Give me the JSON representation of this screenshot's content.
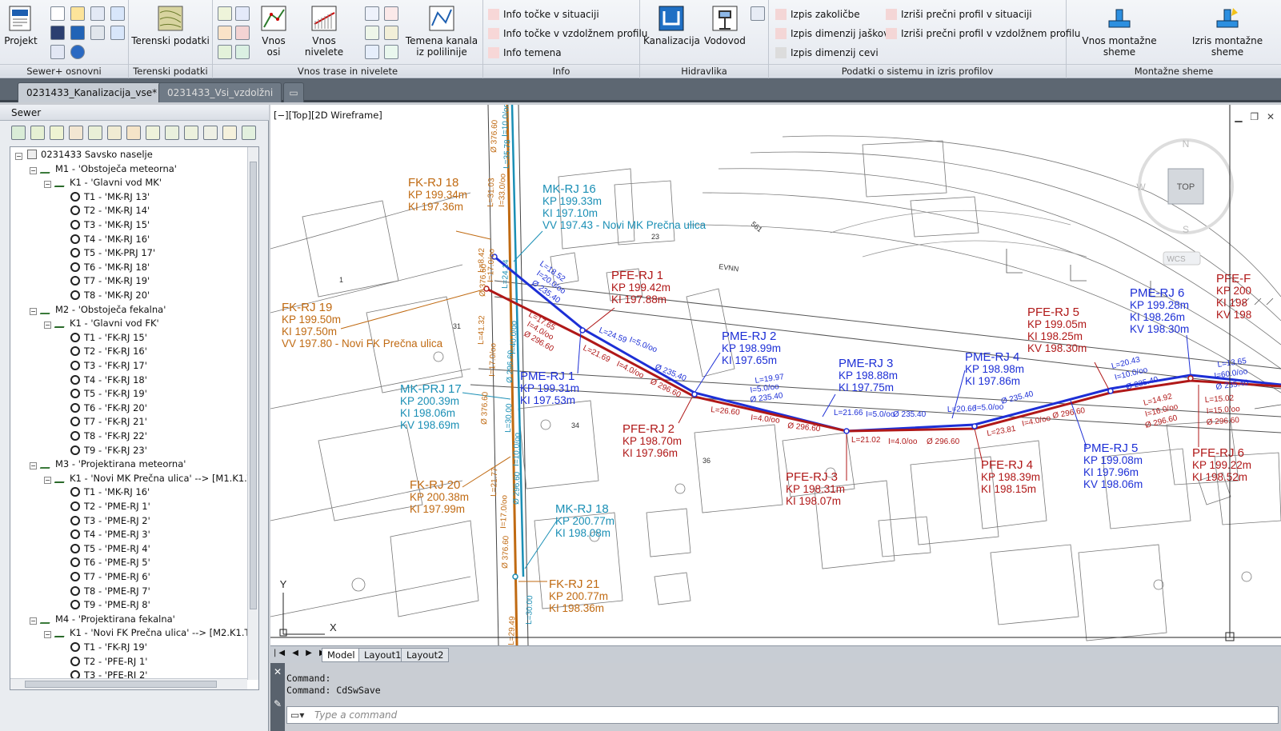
{
  "ribbon": {
    "groups": [
      {
        "label": "Sewer+ osnovni"
      },
      {
        "label": "Terenski podatki"
      },
      {
        "label": "Vnos trase in nivelete"
      },
      {
        "label": "Info"
      },
      {
        "label": "Hidravlika"
      },
      {
        "label": "Podatki o sistemu in izris profilov"
      },
      {
        "label": "Montažne sheme"
      }
    ],
    "buttons": {
      "projekt": "Projekt",
      "terenski": "Terenski podatki",
      "vnos_osi": "Vnos osi",
      "vnos_nivelete": "Vnos nivelete",
      "temena_1": "Temena kanala",
      "temena_2": "iz polilinije",
      "info_situacija": "Info točke v situaciji",
      "info_vzdolzni": "Info točke v vzdolžnem profilu",
      "info_temena": "Info temena",
      "kanalizacija": "Kanalizacija",
      "vodovod": "Vodovod",
      "izpis_zakolicbe": "Izpis zakoličbe",
      "izpis_jaskov": "Izpis dimenzij jaškov",
      "izpis_cevi": "Izpis dimenzij cevi",
      "precni_situacija": "Izriši prečni profil v situaciji",
      "precni_vzdolzni": "Izriši prečni profil v vzdolžnem profilu",
      "vnos_montazne": "Vnos montažne sheme",
      "izris_montazne": "Izris montažne sheme"
    }
  },
  "doc_tabs": [
    {
      "label": "0231433_Kanalizacija_vse*",
      "active": true
    },
    {
      "label": "0231433_Vsi_vzdolžni",
      "active": false
    }
  ],
  "panel": {
    "title": "Sewer",
    "tree": [
      {
        "level": 0,
        "label": "0231433 Savsko naselje",
        "kind": "root"
      },
      {
        "level": 1,
        "label": "M1 - 'Obstoječa meteorna'",
        "kind": "net"
      },
      {
        "level": 2,
        "label": "K1 - 'Glavni vod MK'",
        "kind": "line"
      },
      {
        "level": 3,
        "label": "T1 - 'MK-RJ 13'",
        "kind": "pt"
      },
      {
        "level": 3,
        "label": "T2 - 'MK-RJ 14'",
        "kind": "pt"
      },
      {
        "level": 3,
        "label": "T3 - 'MK-RJ 15'",
        "kind": "pt"
      },
      {
        "level": 3,
        "label": "T4 - 'MK-RJ 16'",
        "kind": "pt"
      },
      {
        "level": 3,
        "label": "T5 - 'MK-PRJ 17'",
        "kind": "pt"
      },
      {
        "level": 3,
        "label": "T6 - 'MK-RJ 18'",
        "kind": "pt"
      },
      {
        "level": 3,
        "label": "T7 - 'MK-RJ 19'",
        "kind": "pt"
      },
      {
        "level": 3,
        "label": "T8 - 'MK-RJ 20'",
        "kind": "pt"
      },
      {
        "level": 1,
        "label": "M2 - 'Obstoječa fekalna'",
        "kind": "net"
      },
      {
        "level": 2,
        "label": "K1 - 'Glavni vod FK'",
        "kind": "line"
      },
      {
        "level": 3,
        "label": "T1 - 'FK-RJ 15'",
        "kind": "pt"
      },
      {
        "level": 3,
        "label": "T2 - 'FK-RJ 16'",
        "kind": "pt"
      },
      {
        "level": 3,
        "label": "T3 - 'FK-RJ 17'",
        "kind": "pt"
      },
      {
        "level": 3,
        "label": "T4 - 'FK-RJ 18'",
        "kind": "pt"
      },
      {
        "level": 3,
        "label": "T5 - 'FK-RJ 19'",
        "kind": "pt"
      },
      {
        "level": 3,
        "label": "T6 - 'FK-RJ 20'",
        "kind": "pt"
      },
      {
        "level": 3,
        "label": "T7 - 'FK-RJ 21'",
        "kind": "pt"
      },
      {
        "level": 3,
        "label": "T8 - 'FK-RJ 22'",
        "kind": "pt"
      },
      {
        "level": 3,
        "label": "T9 - 'FK-RJ 23'",
        "kind": "pt"
      },
      {
        "level": 1,
        "label": "M3 - 'Projektirana meteorna'",
        "kind": "net"
      },
      {
        "level": 2,
        "label": "K1 - 'Novi MK Prečna ulica'  --> [M1.K1.T",
        "kind": "line"
      },
      {
        "level": 3,
        "label": "T1 - 'MK-RJ 16'",
        "kind": "pt"
      },
      {
        "level": 3,
        "label": "T2 - 'PME-RJ 1'",
        "kind": "pt"
      },
      {
        "level": 3,
        "label": "T3 - 'PME-RJ 2'",
        "kind": "pt"
      },
      {
        "level": 3,
        "label": "T4 - 'PME-RJ 3'",
        "kind": "pt"
      },
      {
        "level": 3,
        "label": "T5 - 'PME-RJ 4'",
        "kind": "pt"
      },
      {
        "level": 3,
        "label": "T6 - 'PME-RJ 5'",
        "kind": "pt"
      },
      {
        "level": 3,
        "label": "T7 - 'PME-RJ 6'",
        "kind": "pt"
      },
      {
        "level": 3,
        "label": "T8 - 'PME-RJ 7'",
        "kind": "pt"
      },
      {
        "level": 3,
        "label": "T9 - 'PME-RJ 8'",
        "kind": "pt"
      },
      {
        "level": 1,
        "label": "M4 - 'Projektirana fekalna'",
        "kind": "net"
      },
      {
        "level": 2,
        "label": "K1 - 'Novi FK Prečna ulica'  --> [M2.K1.T",
        "kind": "line"
      },
      {
        "level": 3,
        "label": "T1 - 'FK-RJ 19'",
        "kind": "pt"
      },
      {
        "level": 3,
        "label": "T2 - 'PFE-RJ 1'",
        "kind": "pt"
      },
      {
        "level": 3,
        "label": "T3 - 'PFE-RJ 2'",
        "kind": "pt"
      }
    ]
  },
  "viewport": {
    "label": "[−][Top][2D Wireframe]",
    "viewcube": {
      "top": "TOP",
      "n": "N",
      "s": "S",
      "w": "W",
      "wcs": "WCS"
    },
    "axis": {
      "y": "Y",
      "x": "X"
    },
    "labels": [
      {
        "c": "#c06a12",
        "lines": [
          "FK-RJ 18",
          "KP 199.34m",
          "KI 197.36m"
        ]
      },
      {
        "c": "#1a8fb5",
        "lines": [
          "MK-RJ 16",
          "KP 199.33m",
          "KI 197.10m",
          "VV 197.43 - Novi MK Prečna ulica"
        ]
      },
      {
        "c": "#c06a12",
        "lines": [
          "FK-RJ 19",
          "KP 199.50m",
          "KI 197.50m",
          "VV 197.80 - Novi FK Prečna ulica"
        ]
      },
      {
        "c": "#b01818",
        "lines": [
          "PFE-RJ 1",
          "KP 199.42m",
          "KI 197.88m"
        ]
      },
      {
        "c": "#1a8fb5",
        "lines": [
          "MK-PRJ 17",
          "KP 200.39m",
          "KI 198.06m",
          "KV 198.69m"
        ]
      },
      {
        "c": "#1d2fd6",
        "lines": [
          "PME-RJ 1",
          "KP 199.31m",
          "KI 197.53m"
        ]
      },
      {
        "c": "#1d2fd6",
        "lines": [
          "PME-RJ 2",
          "KP 198.99m",
          "KI 197.65m"
        ]
      },
      {
        "c": "#1d2fd6",
        "lines": [
          "PME-RJ 3",
          "KP 198.88m",
          "KI 197.75m"
        ]
      },
      {
        "c": "#1d2fd6",
        "lines": [
          "PME-RJ 4",
          "KP 198.98m",
          "KI 197.86m"
        ]
      },
      {
        "c": "#b01818",
        "lines": [
          "PFE-RJ 5",
          "KP 199.05m",
          "KI 198.25m",
          "KV 198.30m"
        ]
      },
      {
        "c": "#1d2fd6",
        "lines": [
          "PME-RJ 6",
          "KP 199.28m",
          "KI 198.26m",
          "KV 198.30m"
        ]
      },
      {
        "c": "#b01818",
        "lines": [
          "PFE-RJ 2",
          "KP 198.70m",
          "KI 197.96m"
        ]
      },
      {
        "c": "#c06a12",
        "lines": [
          "FK-RJ 20",
          "KP 200.38m",
          "KI 197.99m"
        ]
      },
      {
        "c": "#b01818",
        "lines": [
          "PFE-RJ 3",
          "KP 198.31m",
          "KI 198.07m"
        ]
      },
      {
        "c": "#b01818",
        "lines": [
          "PFE-RJ 4",
          "KP 198.39m",
          "KI 198.15m"
        ]
      },
      {
        "c": "#1d2fd6",
        "lines": [
          "PME-RJ 5",
          "KP 199.08m",
          "KI 197.96m",
          "KV 198.06m"
        ]
      },
      {
        "c": "#b01818",
        "lines": [
          "PFE-RJ 6",
          "KP 199.22m",
          "KI 198.52m"
        ]
      },
      {
        "c": "#1a8fb5",
        "lines": [
          "MK-RJ 18",
          "KP 200.77m",
          "KI 198.08m"
        ]
      },
      {
        "c": "#c06a12",
        "lines": [
          "FK-RJ 21",
          "KP 200.77m",
          "KI 198.36m"
        ]
      },
      {
        "c": "#b01818",
        "lines": [
          "PFE-F",
          "KP 200",
          "KI 198",
          "KV 198"
        ]
      }
    ],
    "pipe_labels": [
      {
        "c": "#1d2fd6",
        "t": "L=18.52"
      },
      {
        "c": "#1d2fd6",
        "t": "I=20.0/oo"
      },
      {
        "c": "#1d2fd6",
        "t": "Ø 235.40"
      },
      {
        "c": "#b01818",
        "t": "L=17.65"
      },
      {
        "c": "#b01818",
        "t": "I=4.0/oo"
      },
      {
        "c": "#b01818",
        "t": "Ø 296.60"
      },
      {
        "c": "#1d2fd6",
        "t": "L=24.59"
      },
      {
        "c": "#1d2fd6",
        "t": "I=5.0/oo"
      },
      {
        "c": "#1d2fd6",
        "t": "Ø 235.40"
      },
      {
        "c": "#b01818",
        "t": "L=21.69"
      },
      {
        "c": "#b01818",
        "t": "I=4.0/oo"
      },
      {
        "c": "#b01818",
        "t": "Ø 296.60"
      },
      {
        "c": "#1d2fd6",
        "t": "L=19.97"
      },
      {
        "c": "#1d2fd6",
        "t": "I=5.0/oo"
      },
      {
        "c": "#1d2fd6",
        "t": "Ø 235.40"
      },
      {
        "c": "#b01818",
        "t": "L=26.60"
      },
      {
        "c": "#b01818",
        "t": "I=4.0/oo"
      },
      {
        "c": "#b01818",
        "t": "Ø 296.60"
      },
      {
        "c": "#1d2fd6",
        "t": "L=21.66"
      },
      {
        "c": "#1d2fd6",
        "t": "I=5.0/oo"
      },
      {
        "c": "#1d2fd6",
        "t": "Ø 235.40"
      },
      {
        "c": "#b01818",
        "t": "L=21.02"
      },
      {
        "c": "#b01818",
        "t": "I=4.0/oo"
      },
      {
        "c": "#b01818",
        "t": "Ø 296.60"
      },
      {
        "c": "#1d2fd6",
        "t": "L=20.66"
      },
      {
        "c": "#1d2fd6",
        "t": "I=5.0/oo"
      },
      {
        "c": "#1d2fd6",
        "t": "Ø 235.40"
      },
      {
        "c": "#b01818",
        "t": "L=23.81"
      },
      {
        "c": "#b01818",
        "t": "I=4.0/oo"
      },
      {
        "c": "#b01818",
        "t": "Ø 296.60"
      },
      {
        "c": "#1d2fd6",
        "t": "L=20.43"
      },
      {
        "c": "#1d2fd6",
        "t": "I=10.0/oo"
      },
      {
        "c": "#1d2fd6",
        "t": "Ø 235.40"
      },
      {
        "c": "#b01818",
        "t": "L=14.92"
      },
      {
        "c": "#b01818",
        "t": "I=16.0/oo"
      },
      {
        "c": "#b01818",
        "t": "Ø 296.60"
      },
      {
        "c": "#1d2fd6",
        "t": "L=13.65"
      },
      {
        "c": "#1d2fd6",
        "t": "I=60.0/oo"
      },
      {
        "c": "#1d2fd6",
        "t": "Ø 235.40"
      },
      {
        "c": "#b01818",
        "t": "L=15.02"
      },
      {
        "c": "#b01818",
        "t": "I=15.0/oo"
      },
      {
        "c": "#b01818",
        "t": "Ø 296.60"
      },
      {
        "c": "#c06a12",
        "t": "L=31.03"
      },
      {
        "c": "#c06a12",
        "t": "I=33.0/oo"
      },
      {
        "c": "#c06a12",
        "t": "Ø 376.60"
      },
      {
        "c": "#1a8fb5",
        "t": "L=35.78"
      },
      {
        "c": "#1a8fb5",
        "t": "I=10.0/oo"
      },
      {
        "c": "#c06a12",
        "t": "L=8.42"
      },
      {
        "c": "#c06a12",
        "t": "I=17.0/oo"
      },
      {
        "c": "#c06a12",
        "t": "Ø 376.60"
      },
      {
        "c": "#1a8fb5",
        "t": "L=24.14"
      },
      {
        "c": "#1a8fb5",
        "t": "I=40.0/oo"
      },
      {
        "c": "#1a8fb5",
        "t": "Ø 296.60"
      },
      {
        "c": "#c06a12",
        "t": "L=41.32"
      },
      {
        "c": "#c06a12",
        "t": "I=17.0/oo"
      },
      {
        "c": "#c06a12",
        "t": "Ø 376.60"
      },
      {
        "c": "#1a8fb5",
        "t": "L=30.00"
      },
      {
        "c": "#1a8fb5",
        "t": "I=10.0/oo"
      },
      {
        "c": "#1a8fb5",
        "t": "Ø 296.60"
      },
      {
        "c": "#c06a12",
        "t": "L=21.77"
      },
      {
        "c": "#c06a12",
        "t": "I=17.0/oo"
      },
      {
        "c": "#c06a12",
        "t": "Ø 376.60"
      },
      {
        "c": "#1a8fb5",
        "t": "L=30.00"
      },
      {
        "c": "#c06a12",
        "t": "L=29.49"
      }
    ],
    "map_text": [
      {
        "t": "23"
      },
      {
        "t": "31"
      },
      {
        "t": "34"
      },
      {
        "t": "36"
      },
      {
        "t": "1"
      },
      {
        "t": "EVNN"
      },
      {
        "t": "561"
      }
    ]
  },
  "layout_tabs": [
    {
      "label": "Model",
      "active": true
    },
    {
      "label": "Layout1",
      "active": false
    },
    {
      "label": "Layout2",
      "active": false
    }
  ],
  "command": {
    "line1": "Command:",
    "line2": "Command: CdSwSave",
    "placeholder": "Type a command"
  }
}
